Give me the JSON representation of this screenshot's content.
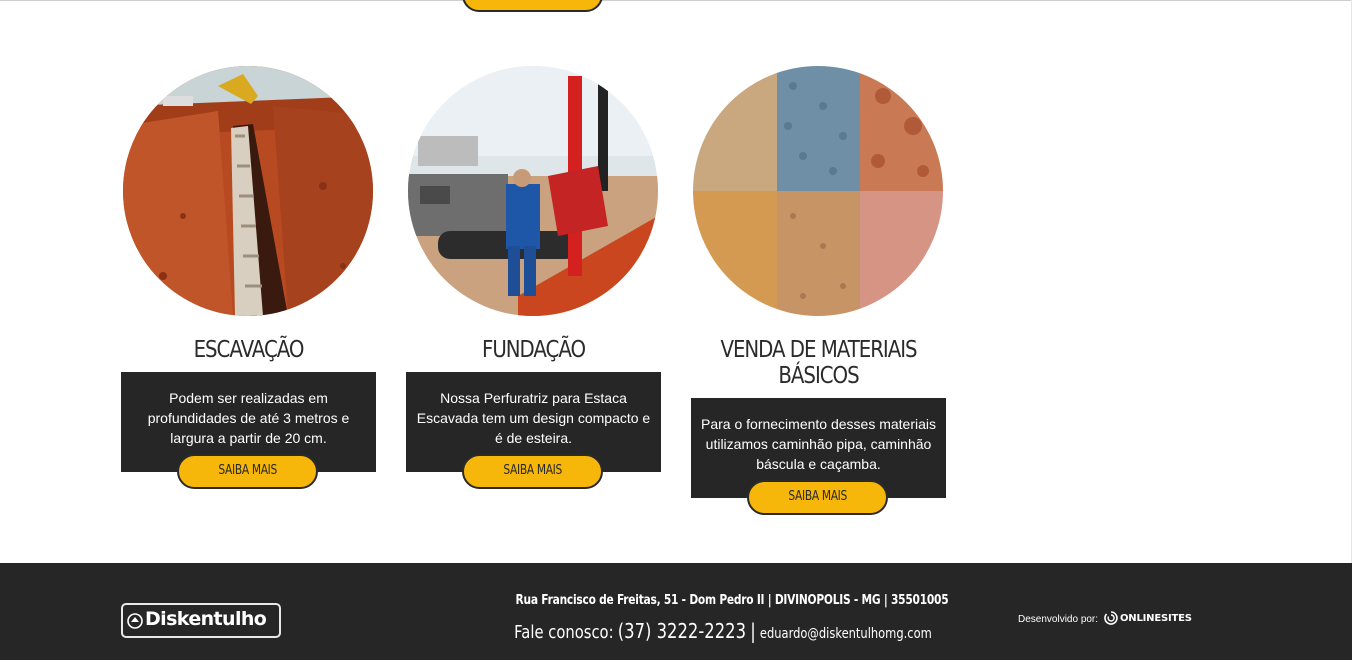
{
  "services": [
    {
      "title": "ESCAVAÇÃO",
      "description": "Podem ser realizadas em profundidades de até 3 metros e largura a partir de 20 cm.",
      "button_label": "SAIBA MAIS"
    },
    {
      "title": "FUNDAÇÃO",
      "description": "Nossa Perfuratriz para Estaca Escavada tem um design compacto e é de esteira.",
      "button_label": "SAIBA MAIS"
    },
    {
      "title": "VENDA DE MATERIAIS BÁSICOS",
      "description": "Para o fornecimento desses materiais utilizamos caminhão pipa, caminhão báscula e caçamba.",
      "button_label": "SAIBA MAIS"
    }
  ],
  "footer": {
    "logo_text": "Diskentulho",
    "address": "Rua Francisco de Freitas, 51 - Dom Pedro II | DIVINOPOLIS - MG | 35501005",
    "contact_label": "Fale conosco:",
    "phone": "(37) 3222-2223",
    "separator": "|",
    "email": "eduardo@diskentulhomg.com",
    "developed_by_label": "Desenvolvido por:",
    "developer_brand": "ONLINESITES"
  },
  "colors": {
    "accent": "#f6b70a",
    "dark": "#262626",
    "title": "#2b2b2b",
    "background": "#ffffff"
  },
  "icons": [
    "logo-mark-icon",
    "onlinesites-mark-icon"
  ]
}
